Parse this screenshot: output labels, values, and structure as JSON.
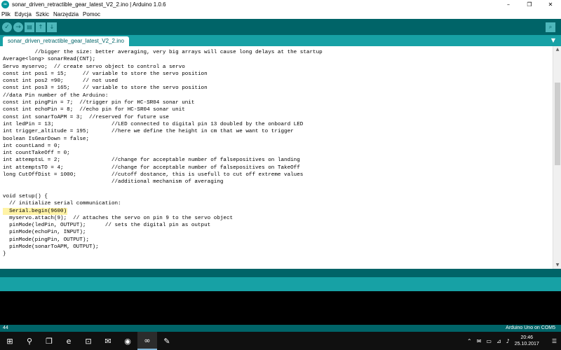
{
  "window": {
    "title": "sonar_driven_retractible_gear_latest_V2_2.ino | Arduino 1.0.6",
    "app_icon": "arduino-icon",
    "controls": [
      "–",
      "❐",
      "✕"
    ]
  },
  "menu": [
    "Plik",
    "Edycja",
    "Szkic",
    "Narzędzia",
    "Pomoc"
  ],
  "toolbar": {
    "verify": "✓",
    "upload": "→",
    "new": "▤",
    "open": "↑",
    "save": "↓",
    "serial_monitor": "⌕"
  },
  "tab": {
    "name": "sonar_driven_retractible_gear_latest_V2_2.ino",
    "menu_icon": "▼"
  },
  "code": [
    "          //bigger the size: better averaging, very big arrays will cause long delays at the startup",
    "Average<long> sonarRead(CNT);",
    "Servo myservo;  // create servo object to control a servo",
    "const int pos1 = 15;     // variable to store the servo position",
    "const int pos2 =90;      // not used",
    "const int pos3 = 165;    // variable to store the servo position",
    "//data Pin number of the Arduino:",
    "const int pingPin = 7;  //trigger pin for HC-SR04 sonar unit",
    "const int echoPin = 8;  //echo pin for HC-SR04 sonar unit",
    "const int sonarToAPM = 3;  //reserved for future use",
    "int ledPin = 13;                  //LED connected to digital pin 13 doubled by the onboard LED",
    "int trigger_altitude = 195;       //here we define the height in cm that we want to trigger",
    "boolean IsGearDown = false;",
    "int countLand = 0;",
    "int countTakeOff = 0;",
    "int attemptsL = 2;                //change for acceptable number of falsepositives on landing",
    "int attemptsTO = 4;               //change for acceptable number of falsepositives on TakeOff",
    "long CutOffDist = 1000;           //cutoff dostance, this is usefull to cut off extreme values",
    "                                  //additional mechanism of averaging",
    "",
    "void setup() {",
    "  // initialize serial communication:",
    "  Serial.begin(9600);",
    "  myservo.attach(9);  // attaches the servo on pin 9 to the servo object",
    "  pinMode(ledPin, OUTPUT);      // sets the digital pin as output",
    "  pinMode(echoPin, INPUT);",
    "  pinMode(pingPin, OUTPUT);",
    "  pinMode(sonarToAPM, OUTPUT);",
    "}"
  ],
  "highlighted_line_index": 22,
  "status": {
    "line": "44",
    "board": "Arduino Uno on COM5"
  },
  "taskbar": {
    "apps": [
      "⊞",
      "⚲",
      "❐",
      "e",
      "⊡",
      "✉",
      "◉",
      "∞",
      "✎"
    ],
    "tray": [
      "⌃",
      "✉",
      "▭",
      "⊿",
      "♪"
    ],
    "time": "20:46",
    "date": "25.10.2017",
    "notifications": "☰"
  },
  "colors": {
    "toolbar": "#006468",
    "tabrow": "#17a1a5",
    "highlight": "#fff3a6"
  }
}
